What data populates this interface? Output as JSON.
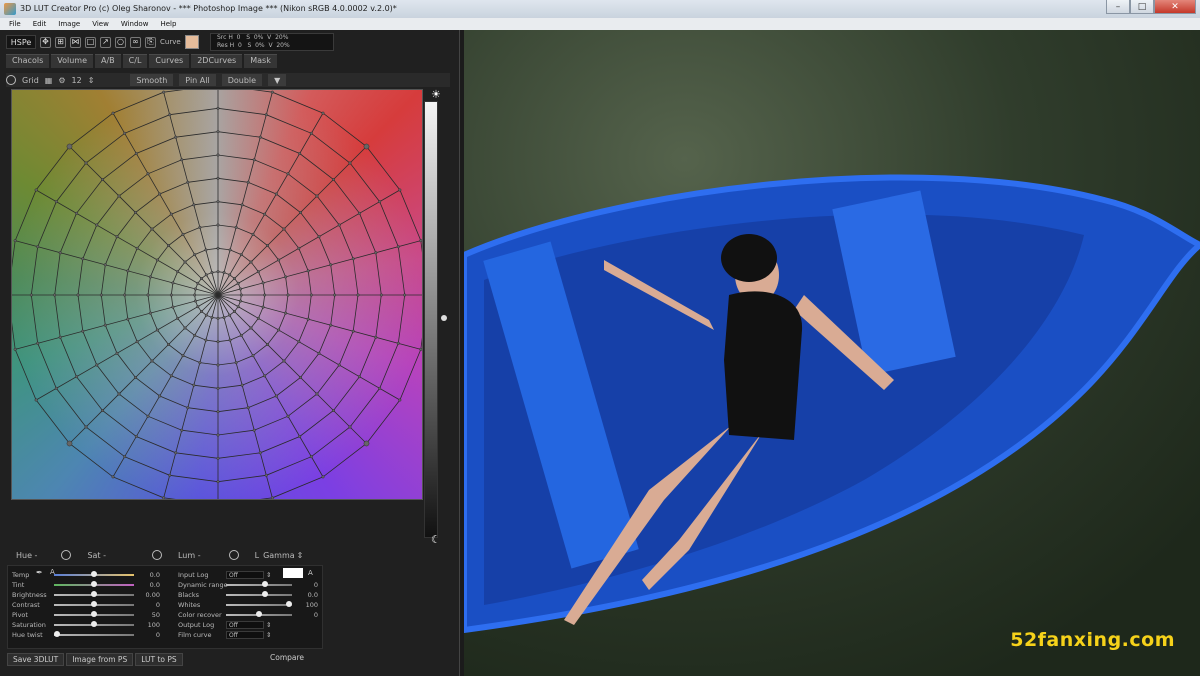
{
  "window": {
    "title": "3D LUT Creator Pro (c) Oleg Sharonov - *** Photoshop Image *** (Nikon sRGB 4.0.0002 v.2.0)*",
    "controls": [
      "minimize-icon",
      "maximize-icon",
      "close-icon"
    ]
  },
  "menu": [
    "File",
    "Edit",
    "Image",
    "View",
    "Window",
    "Help"
  ],
  "toolbar": {
    "mode": "HSPe",
    "tool_icons": [
      "move-icon",
      "transform-icon",
      "distort-icon",
      "select-rect-icon",
      "picker-icon",
      "lasso-icon",
      "link-icon",
      "copy-icon"
    ],
    "curve_label": "Curve",
    "picked_color": "#e5bc9b",
    "readout_line1": "Src H  0   S  0%  V  20%",
    "readout_line2": "Res H  0   S  0%  V  20%"
  },
  "tabs": [
    "Chacols",
    "Volume",
    "A/B",
    "C/L",
    "Curves",
    "2DCurves",
    "Mask"
  ],
  "subbar": {
    "grid_label": "Grid",
    "grid_count": "12",
    "smooth": "Smooth",
    "pin_all": "Pin All",
    "double": "Double"
  },
  "hsl": {
    "hue_label": "Hue -",
    "sat_label": "Sat -",
    "lum_label": "Lum -",
    "gamma_prefix": "L",
    "gamma_label": "Gamma"
  },
  "left_controls": [
    {
      "label": "Temp",
      "value": "0.0",
      "knob": 0.5,
      "style": "temp"
    },
    {
      "label": "Tint",
      "value": "0.0",
      "knob": 0.5,
      "style": "tint"
    },
    {
      "label": "Brightness",
      "value": "0.00",
      "knob": 0.5,
      "style": ""
    },
    {
      "label": "Contrast",
      "value": "0",
      "knob": 0.5,
      "style": ""
    },
    {
      "label": "Pivot",
      "value": "50",
      "knob": 0.5,
      "style": ""
    },
    {
      "label": "Saturation",
      "value": "100",
      "knob": 0.5,
      "style": ""
    },
    {
      "label": "Hue twist",
      "value": "0",
      "knob": 0.0,
      "style": ""
    }
  ],
  "right_controls": [
    {
      "label": "Input Log",
      "type": "dropdown",
      "value": "Off"
    },
    {
      "label": "Dynamic range",
      "type": "slider",
      "value": "0",
      "knob": 0.6
    },
    {
      "label": "Blacks",
      "type": "slider",
      "value": "0.0",
      "knob": 0.6
    },
    {
      "label": "Whites",
      "type": "slider",
      "value": "100",
      "knob": 1.0
    },
    {
      "label": "Color recover",
      "type": "slider",
      "value": "0",
      "knob": 0.5
    },
    {
      "label": "Output Log",
      "type": "dropdown",
      "value": "Off"
    },
    {
      "label": "Film curve",
      "type": "dropdown",
      "value": "Off"
    }
  ],
  "bottom_buttons": [
    "Save 3DLUT",
    "Image from PS",
    "LUT to PS"
  ],
  "compare_label": "Compare",
  "watermark": "52fanxing.com"
}
